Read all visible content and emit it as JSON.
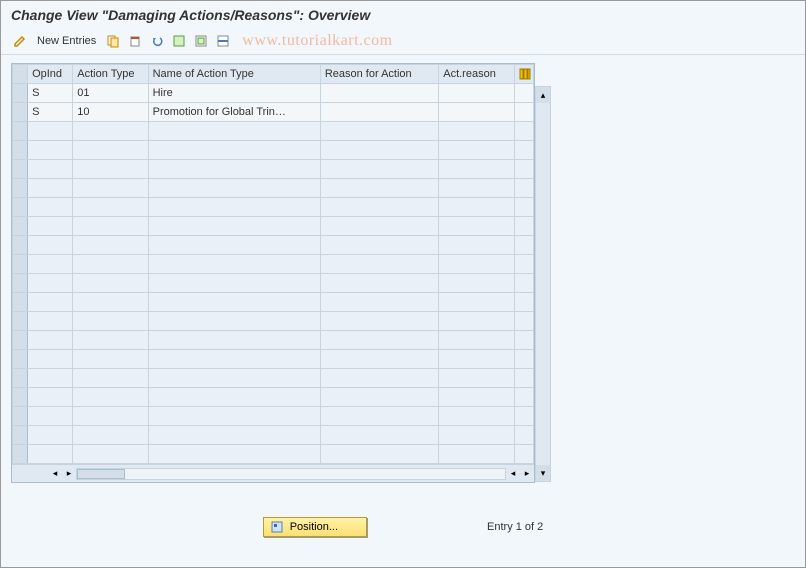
{
  "title": "Change View \"Damaging Actions/Reasons\": Overview",
  "watermark": "www.tutorialkart.com",
  "toolbar": {
    "new_entries": "New Entries"
  },
  "table": {
    "columns": [
      "OpInd",
      "Action Type",
      "Name of Action Type",
      "Reason for Action",
      "Act.reason"
    ],
    "rows": [
      {
        "opind": "S",
        "action_type": "01",
        "name": "Hire",
        "reason": "",
        "act_reason": ""
      },
      {
        "opind": "S",
        "action_type": "10",
        "name": "Promotion for Global Trin…",
        "reason": "",
        "act_reason": ""
      }
    ],
    "empty_rows": 18
  },
  "footer": {
    "position_btn": "Position...",
    "entry_text": "Entry 1 of 2"
  }
}
